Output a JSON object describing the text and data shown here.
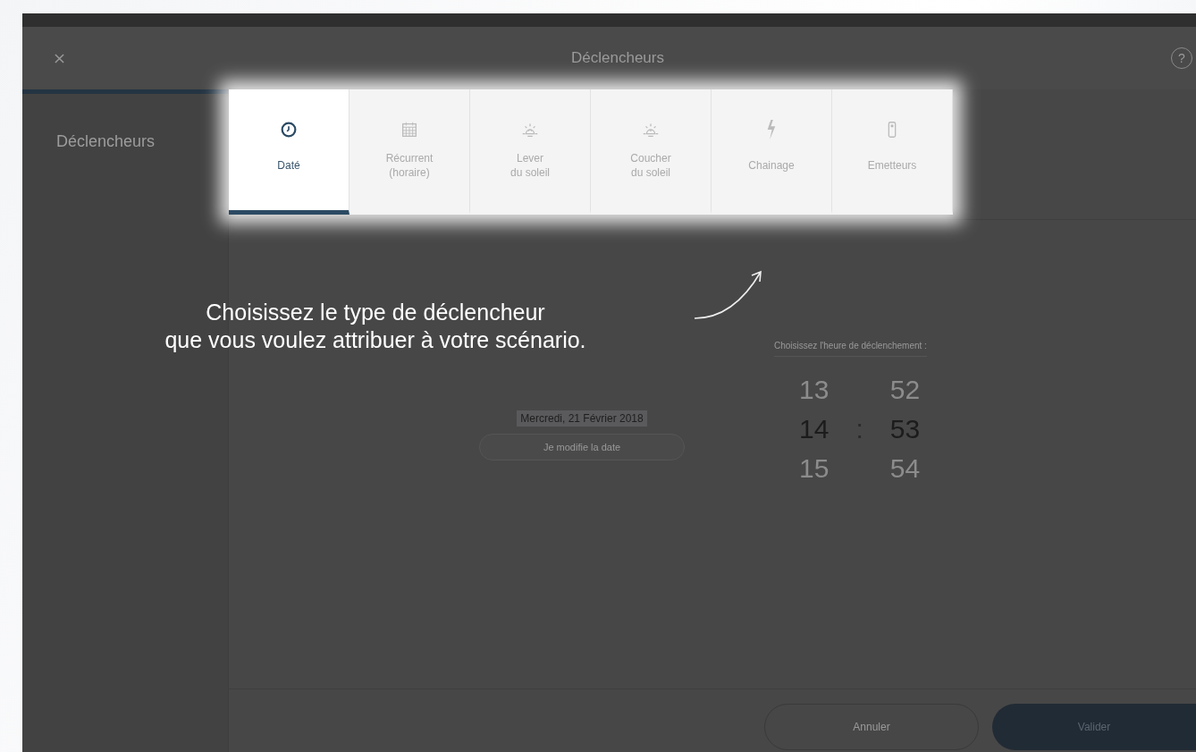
{
  "app_bar": {
    "title": "Déclencheurs",
    "help": "?"
  },
  "sidebar": {
    "items": [
      {
        "label": "Déclencheurs",
        "selected": true
      }
    ]
  },
  "tabs": [
    {
      "label": "Daté",
      "kind": "clock",
      "selected": true
    },
    {
      "label": "Récurrent\n(horaire)",
      "kind": "calendar",
      "selected": false
    },
    {
      "label": "Lever\ndu soleil",
      "kind": "sunrise",
      "selected": false
    },
    {
      "label": "Coucher\ndu soleil",
      "kind": "sunset",
      "selected": false
    },
    {
      "label": "Chainage",
      "kind": "bolt",
      "selected": false
    },
    {
      "label": "Emetteurs",
      "kind": "remote",
      "selected": false
    }
  ],
  "hint": {
    "lines": [
      "Choisissez le type de déclencheur",
      "que vous voulez attribuer à votre scénario."
    ]
  },
  "date": {
    "text": "Mercredi, 21 Février 2018",
    "button": "Je modifie la date"
  },
  "time_picker": {
    "label": "Choisissez l'heure de déclenchement :",
    "separator": ":",
    "hours": [
      {
        "value": "13",
        "selected": false
      },
      {
        "value": "14",
        "selected": true
      },
      {
        "value": "15",
        "selected": false
      }
    ],
    "minutes": [
      {
        "value": "52",
        "selected": false
      },
      {
        "value": "53",
        "selected": true
      },
      {
        "value": "54",
        "selected": false
      }
    ]
  },
  "buttons": {
    "cancel": "Annuler",
    "confirm": "Valider"
  }
}
